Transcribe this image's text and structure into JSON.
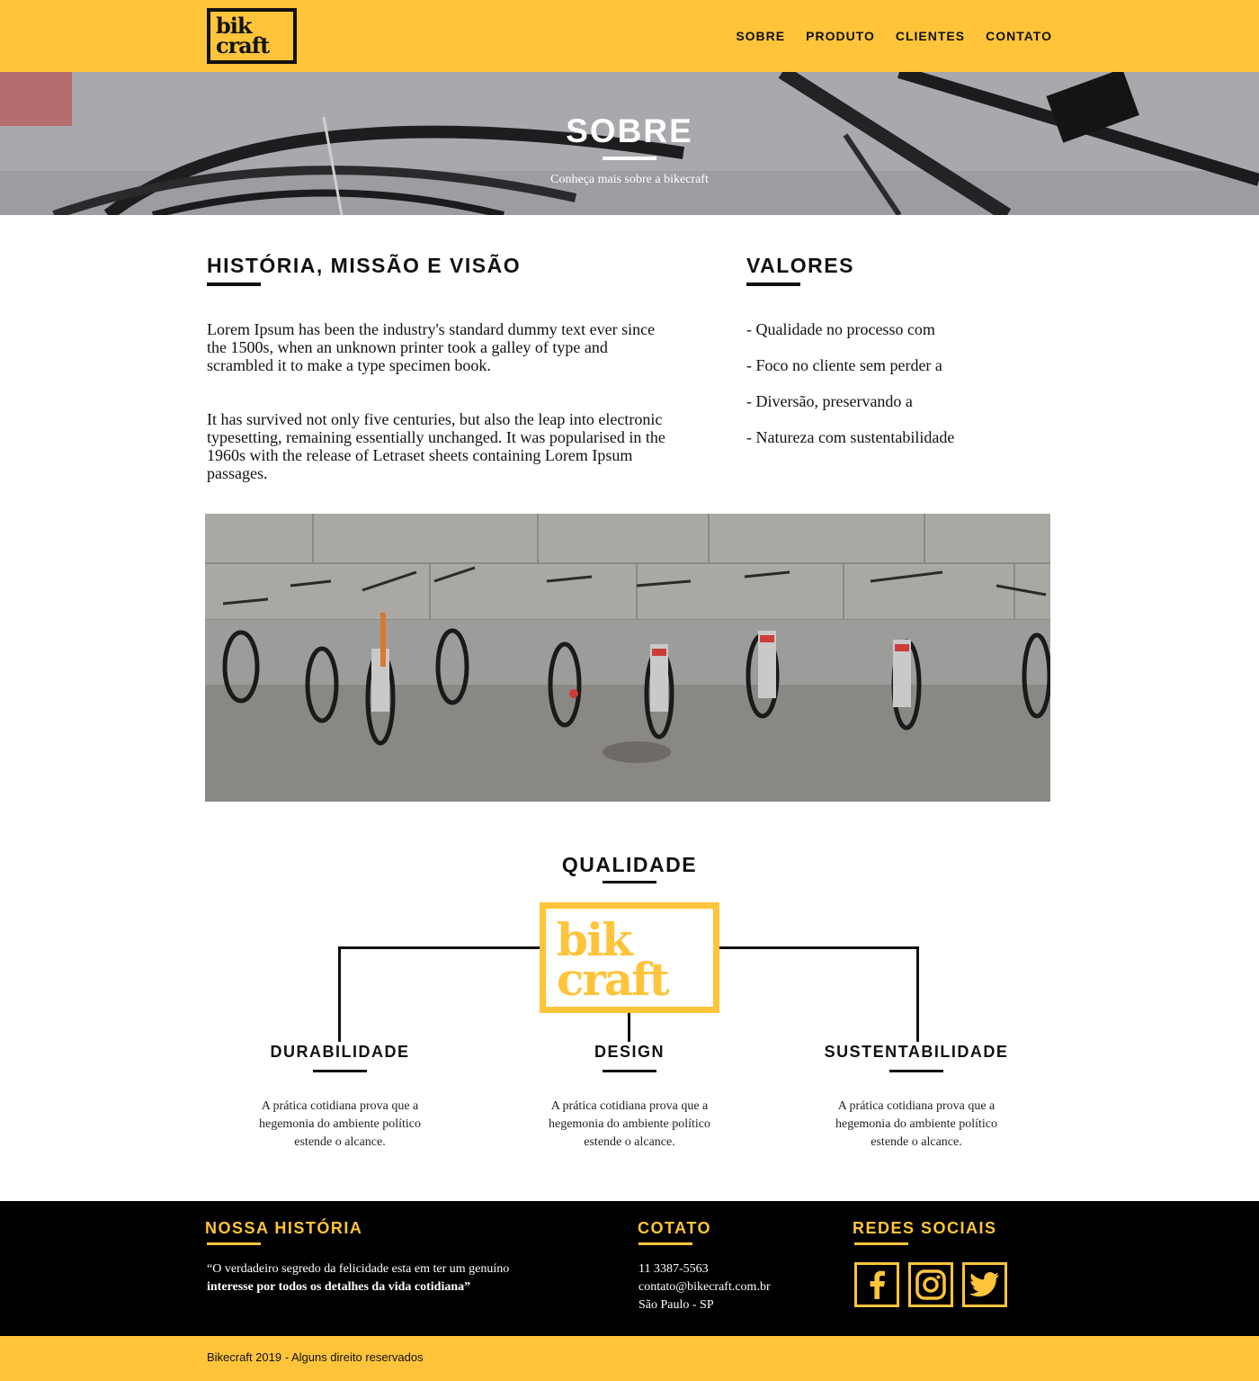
{
  "brand": {
    "logo_line1": "bik",
    "logo_line2": "craft",
    "accent": "#FFC43A",
    "dark": "#000000"
  },
  "nav": [
    {
      "label": "SOBRE"
    },
    {
      "label": "PRODUTO"
    },
    {
      "label": "CLIENTES"
    },
    {
      "label": "CONTATO"
    }
  ],
  "hero": {
    "title": "SOBRE",
    "subtitle": "Conheça mais sobre a bikecraft"
  },
  "historia": {
    "title": "HISTÓRIA, MISSÃO E VISÃO",
    "p1": "Lorem Ipsum has been the industry's standard dummy text ever since the 1500s, when an unknown printer took a galley of type and scrambled it to make a type specimen book.",
    "p2": "It has survived not only five centuries, but also the leap into electronic typesetting, remaining essentially unchanged. It was popularised in the 1960s with the release of Letraset sheets containing Lorem Ipsum passages."
  },
  "valores": {
    "title": "VALORES",
    "items": [
      "- Qualidade no processo com",
      "- Foco no cliente sem perder a",
      "- Diversão, preservando a",
      "- Natureza com sustentabilidade"
    ]
  },
  "qualidade": {
    "title": "QUALIDADE",
    "logo_line1": "bik",
    "logo_line2": "craft",
    "columns": [
      {
        "title": "DURABILIDADE",
        "text": "A prática cotidiana prova que a hegemonia do ambiente político estende o alcance."
      },
      {
        "title": "DESIGN",
        "text": "A prática cotidiana prova que a hegemonia do ambiente político estende o alcance."
      },
      {
        "title": "SUSTENTABILIDADE",
        "text": "A prática cotidiana prova que a hegemonia do ambiente político estende o alcance."
      }
    ]
  },
  "footer": {
    "historia_title": "NOSSA HISTÓRIA",
    "quote_line1": "“O verdadeiro segredo da felicidade esta em ter um genuíno",
    "quote_line2": "interesse por todos os detalhes da vida cotidiana”",
    "contato_title": "COTATO",
    "phone": "11 3387-5563",
    "email": "contato@bikecraft.com.br",
    "city": "São Paulo - SP",
    "social_title": "REDES SOCIAIS",
    "social_icons": [
      "facebook-icon",
      "instagram-icon",
      "twitter-icon"
    ],
    "copyright": "Bikecraft 2019 - Alguns direito reservados"
  }
}
